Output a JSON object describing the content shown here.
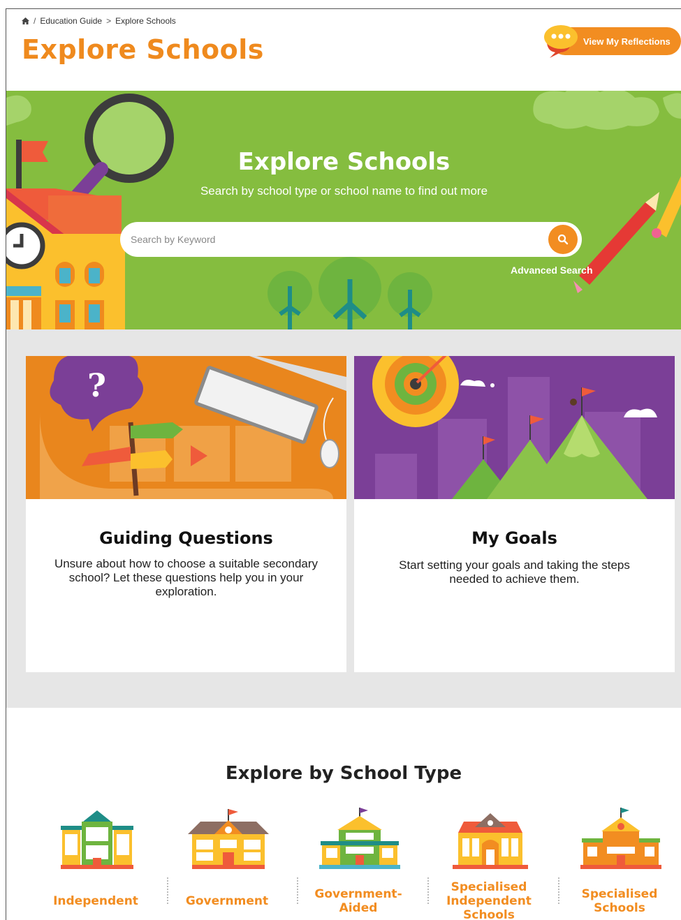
{
  "breadcrumb": {
    "home_icon": "home-icon",
    "separator1": "/",
    "item1": "Education Guide",
    "separator2": ">",
    "item2": "Explore Schools"
  },
  "header": {
    "title": "Explore Schools",
    "reflections_button": "View My Reflections",
    "reflections_icon": "chat-bubble-icon"
  },
  "hero": {
    "title": "Explore Schools",
    "subtitle": "Search by school type or school name to find out more",
    "search_placeholder": "Search by Keyword",
    "search_icon": "search-icon",
    "advanced_search": "Advanced Search"
  },
  "cards": [
    {
      "title": "Guiding Questions",
      "text": "Unsure about how to choose a suitable secondary school? Let these questions help you in your exploration."
    },
    {
      "title": "My Goals",
      "text": "Start setting your goals and taking the steps needed to achieve them."
    }
  ],
  "school_types": {
    "title": "Explore by School Type",
    "items": [
      {
        "label": "Independent",
        "icon": "independent-school-icon"
      },
      {
        "label": "Government",
        "icon": "government-school-icon"
      },
      {
        "label": "Government-Aided",
        "icon": "government-aided-school-icon"
      },
      {
        "label": "Specialised Independent Schools",
        "icon": "specialised-independent-school-icon"
      },
      {
        "label": "Specialised Schools",
        "icon": "specialised-school-icon"
      }
    ]
  },
  "colors": {
    "accent": "#f28d21",
    "hero_green": "#85bd3f",
    "purple": "#7b3f97",
    "orange_card": "#e9861d"
  }
}
